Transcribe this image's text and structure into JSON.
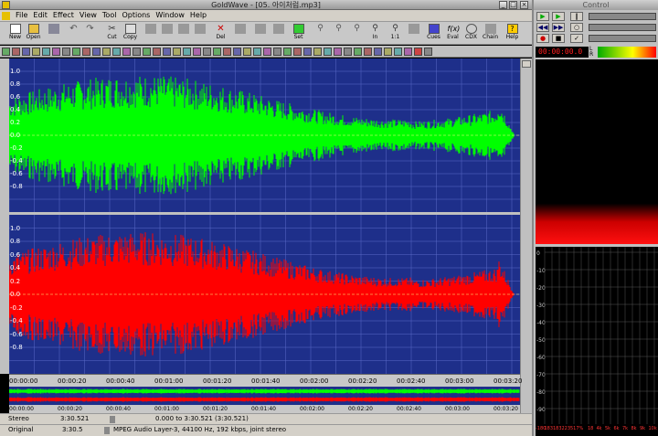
{
  "window": {
    "title": "GoldWave - [05. 아이처럼.mp3]"
  },
  "menu": [
    "File",
    "Edit",
    "Effect",
    "View",
    "Tool",
    "Options",
    "Window",
    "Help"
  ],
  "toolbar": {
    "new": "New",
    "open": "Open",
    "cut": "Cut",
    "copy": "Copy",
    "del": "Del",
    "set": "Set",
    "in": "In",
    "x1": "1:1",
    "cues": "Cues",
    "eval": "Eval",
    "cdx": "CDX",
    "chain": "Chain",
    "help": "Help"
  },
  "yaxis": [
    "1.0",
    "0.8",
    "0.6",
    "0.4",
    "0.2",
    "0.0",
    "-0.2",
    "-0.4",
    "-0.6",
    "-0.8"
  ],
  "timeline": [
    "00:00:00",
    "00:00:20",
    "00:00:40",
    "00:01:00",
    "00:01:20",
    "00:01:40",
    "00:02:00",
    "00:02:20",
    "00:02:40",
    "00:03:00",
    "00:03:20"
  ],
  "status": {
    "mode": "Stereo",
    "length": "3:30.521",
    "range": "0.000 to 3:30.521 (3:30.521)",
    "orig_label": "Original",
    "orig_len": "3:30.5",
    "format": "MPEG Audio Layer-3, 44100 Hz, 192 kbps, joint stereo"
  },
  "control": {
    "title": "Control",
    "time": "00:00:00.0",
    "lr": [
      "L",
      "R"
    ],
    "meter_ticks": [
      "0",
      "-10",
      "-20",
      "-30",
      "-40",
      "-50",
      "-60",
      "-70",
      "-80",
      "-90"
    ],
    "freq_ticks": [
      "-180",
      "183",
      "183",
      "223",
      "517",
      "%",
      "18",
      "4k",
      "5k",
      "6k",
      "7k",
      "8k",
      "9k",
      "10k"
    ]
  },
  "colors": {
    "left": "#00ff00",
    "right": "#ff0000",
    "wave_bg": "#1e2f8a"
  }
}
